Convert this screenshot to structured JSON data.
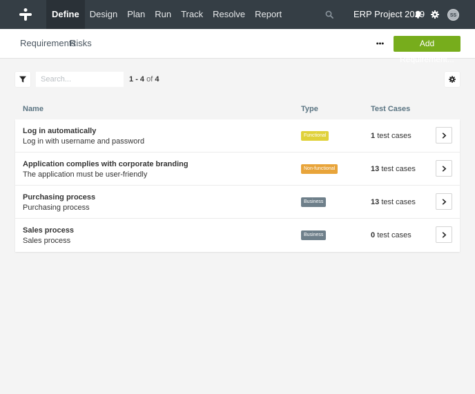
{
  "nav": {
    "items": [
      {
        "label": "Define",
        "active": true
      },
      {
        "label": "Design",
        "active": false
      },
      {
        "label": "Plan",
        "active": false
      },
      {
        "label": "Run",
        "active": false
      },
      {
        "label": "Track",
        "active": false
      },
      {
        "label": "Resolve",
        "active": false
      },
      {
        "label": "Report",
        "active": false
      }
    ],
    "project_name": "ERP Project 2019",
    "avatar_initials": "SS"
  },
  "subnav": {
    "tabs": [
      "Requirements",
      "Risks"
    ],
    "add_button_label": "Add Requirement..."
  },
  "toolbar": {
    "search_placeholder": "Search...",
    "range_start": "1",
    "range_end": "4",
    "range_of": "of",
    "total": "4"
  },
  "table": {
    "columns": [
      "Name",
      "Type",
      "Test Cases"
    ],
    "rows": [
      {
        "title": "Log in automatically",
        "description": "Log in with username and password",
        "type": "Functional",
        "type_color": "#e0d13a",
        "count": "1",
        "count_suffix": "test cases"
      },
      {
        "title": "Application complies with corporate branding",
        "description": "The application must be user-friendly",
        "type": "Non-functional",
        "type_color": "#e8a43a",
        "count": "13",
        "count_suffix": "test cases"
      },
      {
        "title": "Purchasing process",
        "description": "Purchasing process",
        "type": "Business",
        "type_color": "#6e7f8a",
        "count": "13",
        "count_suffix": "test cases"
      },
      {
        "title": "Sales process",
        "description": "Sales process",
        "type": "Business",
        "type_color": "#6e7f8a",
        "count": "0",
        "count_suffix": "test cases"
      }
    ]
  },
  "colors": {
    "topbar": "#353e45",
    "accent_green": "#77ad1c"
  }
}
